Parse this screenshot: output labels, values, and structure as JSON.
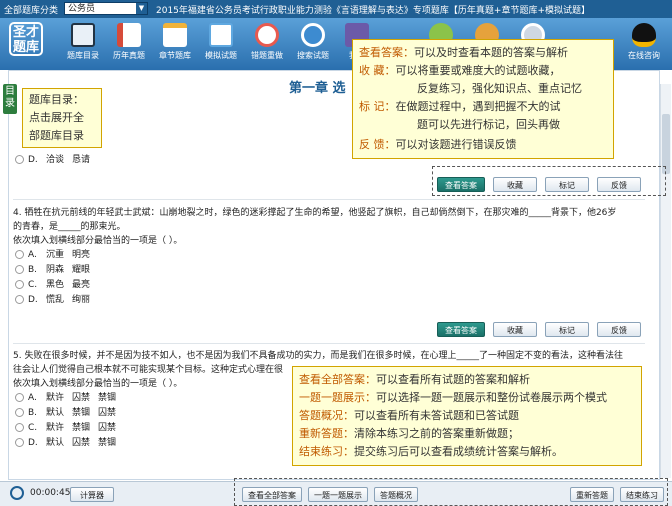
{
  "topbar": {
    "category_label": "全部题库分类",
    "category_select": "公务员",
    "title": "2015年福建省公务员考试行政职业能力测验《言语理解与表达》专项题库【历年真题+章节题库+模拟试题】"
  },
  "toolbar": {
    "logo_text": "圣才题库",
    "items": [
      {
        "label": "题库目录",
        "color": "#e9f0f7"
      },
      {
        "label": "历年真题",
        "color": "#d64b3a"
      },
      {
        "label": "章节题库",
        "color": "#f0b33a"
      },
      {
        "label": "模拟试题",
        "color": "#5fa8e0"
      },
      {
        "label": "错题重做",
        "color": "#e85a4f"
      },
      {
        "label": "搜索试题",
        "color": "#3d8bd0"
      },
      {
        "label": "我的",
        "color": "#6b5aa8"
      }
    ],
    "consult_label": "在线咨询"
  },
  "sidebar_tab": "目录",
  "chapter_title": "第一章 选",
  "question_prev_partial": {
    "option_d": {
      "letter": "D.",
      "w1": "洽谈",
      "w2": "恳请"
    }
  },
  "questions": [
    {
      "stem_line1": "4. 牺牲在抗元前线的年轻武士武斌：山崩地裂之时，绿色的迷彩撑起了生命的希望，他竖起了旗帜，自己却倘然倒下，在那灾难的_____背景下，他26岁",
      "stem_line2": "的青春，是_____的那束光。",
      "prompt": "依次填入划横线部分最恰当的一项是（     ）。",
      "options": [
        {
          "letter": "A.",
          "w1": "沉重",
          "w2": "明亮"
        },
        {
          "letter": "B.",
          "w1": "阴森",
          "w2": "耀眼"
        },
        {
          "letter": "C.",
          "w1": "黑色",
          "w2": "最亮"
        },
        {
          "letter": "D.",
          "w1": "慌乱",
          "w2": "绚丽"
        }
      ]
    },
    {
      "stem_line1": "5. 失败在很多时候，并不是因为技不如人，也不是因为我们不具备成功的实力，而是我们在很多时候，在心理上_____了一种固定不变的看法，这种看法往",
      "stem_line2": "往会让人们觉得自己根本就不可能实现某个目标。这种定式心理在很",
      "prompt": "依次填入划横线部分最恰当的一项是（     ）。",
      "options": [
        {
          "letter": "A.",
          "w1": "默许",
          "w2": "囚禁",
          "w3": "禁锢"
        },
        {
          "letter": "B.",
          "w1": "默认",
          "w2": "禁锢",
          "w3": "囚禁"
        },
        {
          "letter": "C.",
          "w1": "默许",
          "w2": "禁锢",
          "w3": "囚禁"
        },
        {
          "letter": "D.",
          "w1": "默认",
          "w2": "囚禁",
          "w3": "禁锢"
        }
      ]
    }
  ],
  "question_actions": {
    "view_answer": "查看答案",
    "favorite": "收藏",
    "mark": "标记",
    "feedback": "反馈"
  },
  "bottombar": {
    "timer": "00:00:45",
    "calculator": "计算器",
    "view_all_answers": "查看全部答案",
    "one_by_one": "一题一题展示",
    "overview": "答题概况",
    "restart": "重新答题",
    "finish": "结束练习"
  },
  "tip_catalog": {
    "title": "题库目录：",
    "line2": "点击展开全",
    "line3": "部题库目录"
  },
  "tip_actions": {
    "r1k": "查看答案：",
    "r1v": "可以及时查看本题的答案与解析",
    "r2k": "收      藏：",
    "r2v": "可以将重要或难度大的试题收藏，",
    "r3v": "反复练习，强化知识点、重点记忆",
    "r4k": "标      记：",
    "r4v": "在做题过程中，遇到把握不大的试",
    "r5v": "题可以先进行标记，回头再做",
    "r6k": "反      馈：",
    "r6v": "可以对该题进行错误反馈"
  },
  "tip_bottom": {
    "r1k": "查看全部答案：",
    "r1v": "可以查看所有试题的答案和解析",
    "r2k": "一题一题展示：",
    "r2v": "可以选择一题一题展示和整份试卷展示两个模式",
    "r3k": "答题概况：",
    "r3v": "可以查看所有未答试题和已答试题",
    "r4k": "重新答题：",
    "r4v": "清除本练习之前的答案重新做题；",
    "r5k": "结束练习：",
    "r5v": "提交练习后可以查看成绩统计答案与解析。"
  }
}
